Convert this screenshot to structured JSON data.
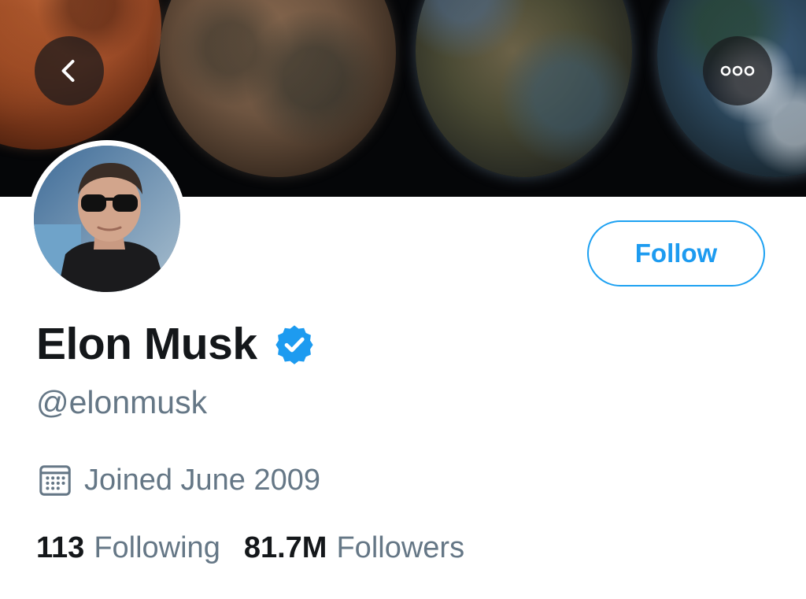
{
  "header": {
    "back_icon": "chevron-left-icon",
    "more_icon": "more-options-icon"
  },
  "profile": {
    "display_name": "Elon Musk",
    "verified_icon": "verified-badge-icon",
    "handle": "@elonmusk",
    "joined_icon": "calendar-icon",
    "joined": "Joined June 2009",
    "follow_label": "Follow"
  },
  "stats": {
    "following_count": "113",
    "following_label": "Following",
    "followers_count": "81.7M",
    "followers_label": "Followers"
  },
  "colors": {
    "accent": "#1da1f2",
    "text_primary": "#14171a",
    "text_secondary": "#657786",
    "banner_bg": "#050608"
  }
}
